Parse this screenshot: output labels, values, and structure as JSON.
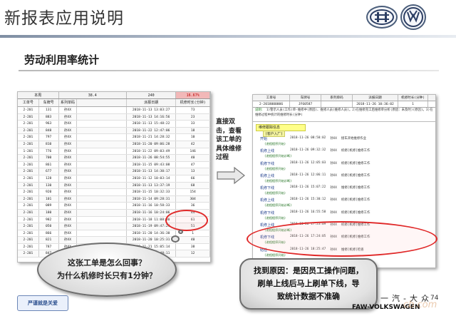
{
  "slide": {
    "title": "新报表应用说明",
    "section_title": "劳动利用率统计",
    "page_number": "74"
  },
  "left_report": {
    "header_cells": [
      "本周",
      "38.4",
      "240",
      "16.67%"
    ],
    "columns": [
      "工单号",
      "车牌号",
      "系列单码",
      "派报日期",
      "机修时长(分钟)"
    ],
    "rows": [
      [
        "2-201",
        "131",
        "孙XX",
        "2018-11-13 13:03:27",
        "73"
      ],
      [
        "2-201",
        "883",
        "孙XX",
        "2018-11-13 14:16:56",
        "23"
      ],
      [
        "2-201",
        "963",
        "孙XX",
        "2018-11-13 15:48:22",
        "33"
      ],
      [
        "2-201",
        "848",
        "孙XX",
        "2018-11-22 12:47:06",
        "18"
      ],
      [
        "2-201",
        "797",
        "孙XX",
        "2018-11-21 14:28:32",
        "10"
      ],
      [
        "2-201",
        "810",
        "孙XX",
        "2018-11-20 09:06:28",
        "42"
      ],
      [
        "1-201",
        "776",
        "孙XX",
        "2018-11-22 09:03:49",
        "146"
      ],
      [
        "2-201",
        "700",
        "孙XX",
        "2018-11-26 08:54:55",
        "40"
      ],
      [
        "2-201",
        "861",
        "孙XX",
        "2018-11-15 09:43:08",
        "47"
      ],
      [
        "2-201",
        "677",
        "孙XX",
        "2018-11-13 14:30:17",
        "13"
      ],
      [
        "2-201",
        "128",
        "孙XX",
        "2018-11-12 10:03:14",
        "66"
      ],
      [
        "2-201",
        "130",
        "孙XX",
        "2018-11-13 13:37:19",
        "68"
      ],
      [
        "2-201",
        "920",
        "孙XX",
        "2018-11-15 10:32:33",
        "154"
      ],
      [
        "2-201",
        "101",
        "孙XX",
        "2018-11-14 09:28:31",
        "304"
      ],
      [
        "2-201",
        "089",
        "孙XX",
        "2018-11-16 10:58:33",
        "36"
      ],
      [
        "2-201",
        "180",
        "孙XX",
        "2018-11-16 10:24:06",
        "44"
      ],
      [
        "2-201",
        "982",
        "孙XX",
        "2018-11-18 11:08:30",
        "61"
      ],
      [
        "2-201",
        "050",
        "孙XX",
        "2018-11-19 09:47:24",
        "51"
      ],
      [
        "2-201",
        "866",
        "孙XX",
        "2018-11-20 14:36:30",
        "1"
      ],
      [
        "2-201",
        "821",
        "孙XX",
        "2018-11-20 10:25:31",
        "40"
      ],
      [
        "2-201",
        "787",
        "孙XX",
        "2018-11-21 15:05:14",
        "38"
      ],
      [
        "2-201",
        "847",
        "孙XX",
        "2018-11-22 09:48:11",
        "12"
      ]
    ]
  },
  "middle": {
    "annotation": "直接双击，查看该工单的具体维修过程"
  },
  "right_report": {
    "columns": [
      "工单号",
      "车牌号",
      "系列单码",
      "派报日期",
      "机修时长(分钟)"
    ],
    "values": [
      "2-2018000006",
      "JF60587",
      "",
      "2018-11-26 10:36:02",
      "1"
    ],
    "desc_title": "说明：",
    "desc_text": "1)警示人员(工作)单-维修中(原因)、维修人员(维修人员)。2)在维修完工后维修单分析(原因：未及时)(原因)。3)在维修过程中统计的维修时长(分钟)",
    "section_label": "维修跟踪信息",
    "process_label": "(客户入厂)",
    "steps": [
      {
        "label": "开始",
        "sub": "(进程程序开始)",
        "time": "2018-11-26 08:50:02",
        "person": "孙XX",
        "note": "接车开始维修作业"
      },
      {
        "label": "机修上线",
        "sub": "(进程程序开始诊断)",
        "time": "2018-11-26 09:32:32",
        "person": "孙XX",
        "note": "机修[机修]维修工作"
      },
      {
        "label": "机修下线",
        "sub": "(进程程序开始)",
        "time": "2018-11-26 12:05:03",
        "person": "孙XX",
        "note": "机修[机修]维修工作"
      },
      {
        "label": "机修上线",
        "sub": "(进程程序开始诊断)",
        "time": "2018-11-26 12:06:11",
        "person": "孙XX",
        "note": "机修[机修]维修工作"
      },
      {
        "label": "机修下线",
        "sub": "(进程程序开始)",
        "time": "2018-11-26 15:07:22",
        "person": "孙XX",
        "note": "维修[机修]维修工作"
      },
      {
        "label": "机修上线",
        "sub": "(进程程序开始诊断)",
        "time": "2018-11-26 15:30:12",
        "person": "孙XX",
        "note": "机修[机修]维修工作"
      },
      {
        "label": "机修下线",
        "sub": "(进程程序开始)",
        "time": "2018-11-26 16:55:58",
        "person": "孙XX",
        "note": "机修[机修]维修工作"
      },
      {
        "label": "机修上线",
        "sub": "(进程程序开始诊断)",
        "time": "2018-11-26 17:23:09",
        "person": "孙XX",
        "note": "机修[机修]维修工作"
      },
      {
        "label": "机修下线",
        "sub": "(进程程序开始)",
        "time": "2018-11-26 17:24:05",
        "person": "孙XX",
        "note": "机修[机修]维修工作"
      },
      {
        "label": "结检",
        "sub": "(进程程序开始)",
        "time": "2018-11-26 18:25:47",
        "person": "孙XX",
        "note": "维修[机修]检查"
      }
    ]
  },
  "bubbles": {
    "question_line1": "这张工单是怎么回事？",
    "question_line2": "为什么机修时长只有1分钟？",
    "answer_line1": "找到原因：是因员工操作问题，",
    "answer_line2": "刷单上线后马上刷单下线，导",
    "answer_line3": "致统计数据不准确"
  },
  "footer": {
    "left_logo_text": "严谨就是关爱",
    "cn_brand": "一汽-大众",
    "brand": "FAW-VOLKSWAGEN",
    "watermark": "cb.com"
  },
  "colors": {
    "highlight_red": "#e02828",
    "ratio_cell": "#f2b8b8",
    "step_tag": "#f4f4a0"
  }
}
